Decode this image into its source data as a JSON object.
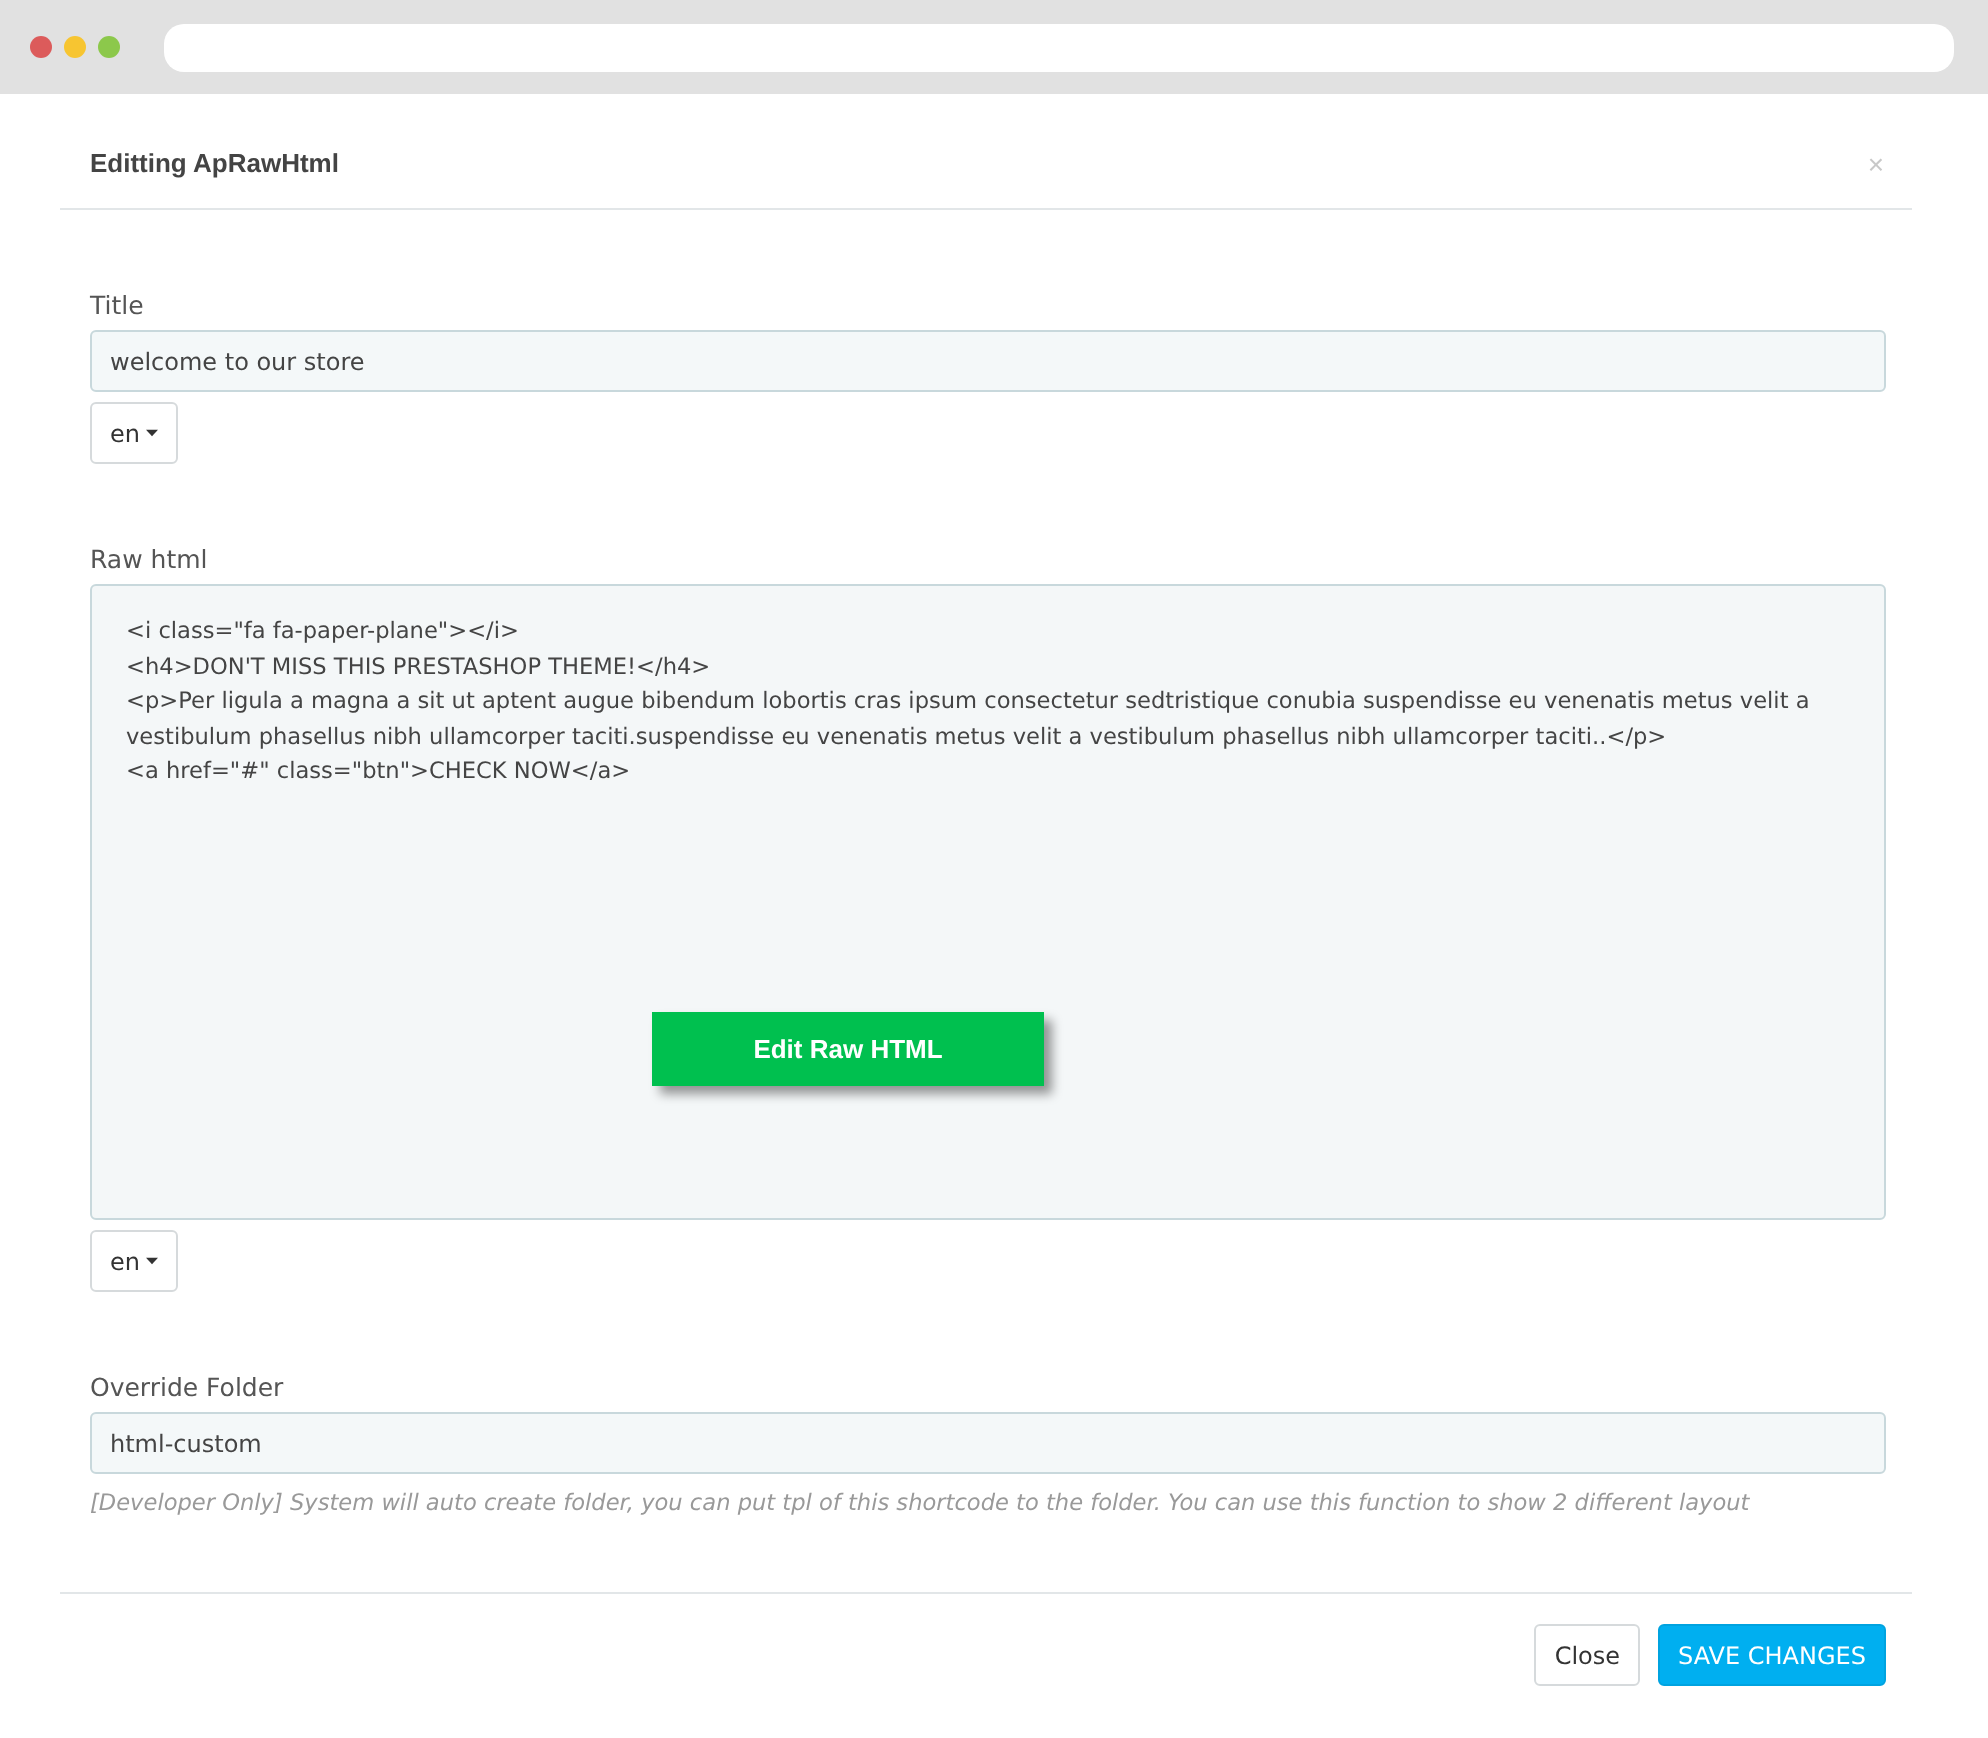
{
  "modal": {
    "title": "Editting ApRawHtml",
    "close_symbol": "×"
  },
  "fields": [
    {
      "kind": "input",
      "label": "Title",
      "value": "welcome to our store",
      "language": "en"
    },
    {
      "kind": "code",
      "label": "Raw html",
      "lines": [
        "<i class=\"fa fa-paper-plane\"></i>",
        "<h4>DON'T MISS THIS PRESTASHOP THEME!</h4>",
        "<p>Per ligula a magna a sit ut aptent augue bibendum lobortis cras ipsum consectetur sedtristique conubia suspendisse eu venenatis metus velit a vestibulum phasellus nibh ullamcorper taciti.suspendisse eu venenatis metus velit a vestibulum phasellus nibh ullamcorper taciti..</p>",
        "<a href=\"#\" class=\"btn\">CHECK NOW</a>"
      ],
      "overlay_label": "Edit Raw HTML",
      "language": "en"
    },
    {
      "kind": "input",
      "label": "Override Folder",
      "value": "html-custom",
      "help": "[Developer Only] System will auto create folder, you can put tpl of this shortcode to the folder. You can use this function to show 2 different layout"
    }
  ],
  "buttons": [
    {
      "label": "Close",
      "kind": "default"
    },
    {
      "label": "SAVE CHANGES",
      "kind": "primary"
    }
  ]
}
